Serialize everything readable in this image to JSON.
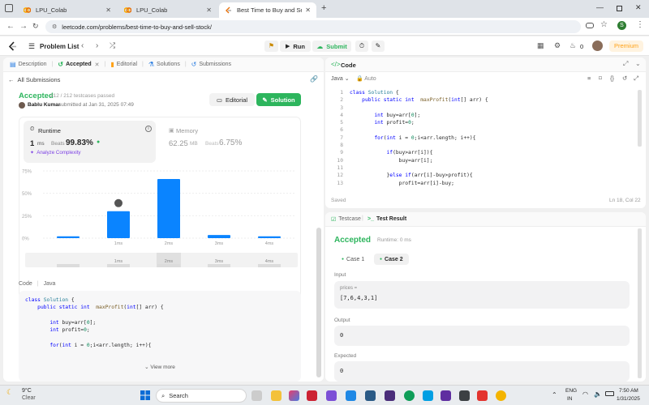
{
  "browser": {
    "tabs": [
      {
        "title": "LPU_Colab",
        "active": false
      },
      {
        "title": "LPU_Colab",
        "active": false
      },
      {
        "title": "Best Time to Buy and Sell Stock",
        "active": true
      }
    ],
    "url": "leetcode.com/problems/best-time-to-buy-and-sell-stock/",
    "profile_initial": "S"
  },
  "header": {
    "problem_list": "Problem List",
    "run": "Run",
    "submit": "Submit",
    "streak": "0",
    "premium": "Premium",
    "lc_notif": "0"
  },
  "left_tabs": [
    "Description",
    "Accepted",
    "Editorial",
    "Solutions",
    "Submissions"
  ],
  "submission": {
    "back": "All Submissions",
    "status": "Accepted",
    "cases": "212 / 212 testcases passed",
    "user": "Bablu Kumar",
    "submitted": "submitted at Jan 31, 2025 07:49",
    "editorial_btn": "Editorial",
    "solution_btn": "Solution",
    "runtime_label": "Runtime",
    "runtime_value": "1",
    "runtime_unit": "ms",
    "beats_label": "Beats",
    "runtime_beats": "99.83%",
    "analyze": "Analyze Complexity",
    "memory_label": "Memory",
    "memory_value": "62.25",
    "memory_unit": "MB",
    "memory_beats_label": "Beats",
    "memory_beats": "6.75%"
  },
  "chart_data": {
    "type": "bar",
    "categories": [
      "",
      "1ms",
      "2ms",
      "3ms",
      "4ms"
    ],
    "values": [
      2,
      30,
      66,
      3.5,
      2
    ],
    "ylim": [
      0,
      75
    ],
    "yticks": [
      "75%",
      "50%",
      "25%",
      "0%"
    ],
    "highlight_index": 1
  },
  "minimap_labels": [
    "",
    "1ms",
    "2ms",
    "3ms",
    "4ms"
  ],
  "code_section": {
    "code_label": "Code",
    "lang": "Java",
    "view_more": "View more",
    "lines": [
      "class Solution {",
      "    public static int  maxProfit(int[] arr) {",
      "",
      "        int buy=arr[0];",
      "        int profit=0;",
      "",
      "        for(int i = 0;i<arr.length; i++){"
    ]
  },
  "editor": {
    "title": "Code",
    "lang": "Java",
    "mode": "Auto",
    "saved": "Saved",
    "position": "Ln 18, Col 22",
    "lines": [
      "class Solution {",
      "    public static int  maxProfit(int[] arr) {",
      "",
      "        int buy=arr[0];",
      "        int profit=0;",
      "",
      "        for(int i = 0;i<arr.length; i++){",
      "",
      "            if(buy>arr[i]){",
      "                buy=arr[i];",
      "",
      "            }else if(arr[i]-buy>profit){",
      "                profit=arr[i]-buy;"
    ]
  },
  "result": {
    "testcase_tab": "Testcase",
    "result_tab": "Test Result",
    "status": "Accepted",
    "runtime": "Runtime: 0 ms",
    "cases": [
      "Case 1",
      "Case 2"
    ],
    "input_label": "Input",
    "param_name": "prices =",
    "param_value": "[7,6,4,3,1]",
    "output_label": "Output",
    "output_value": "0",
    "expected_label": "Expected",
    "expected_value": "0"
  },
  "taskbar": {
    "temp": "9°C",
    "weather": "Clear",
    "search": "Search",
    "lang1": "ENG",
    "lang2": "IN",
    "time": "7:50 AM",
    "date": "1/31/2025"
  },
  "colors": {
    "accepted": "#2db55d",
    "chart_bar": "#0a84ff",
    "premium": "#ffa116"
  }
}
